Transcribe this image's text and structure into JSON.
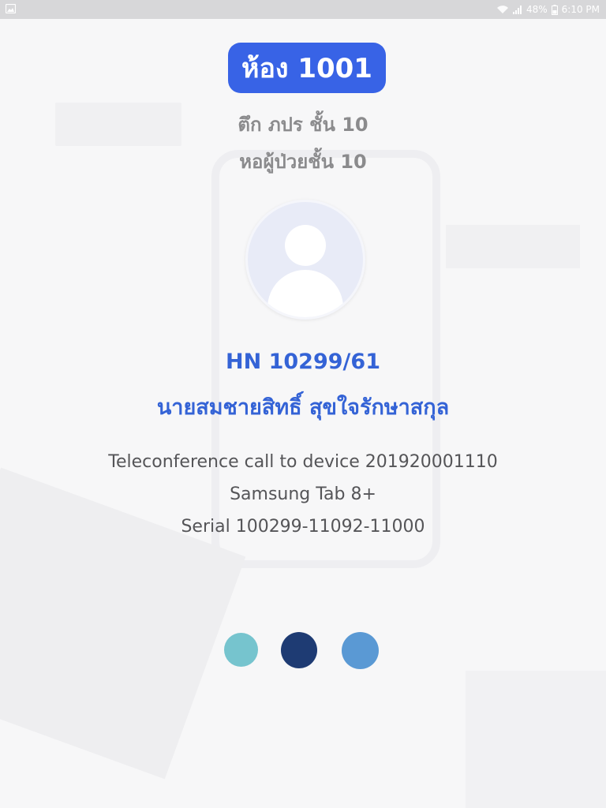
{
  "status_bar": {
    "battery": "48%",
    "time": "6:10 PM",
    "icons": [
      "gallery-icon",
      "wifi-icon",
      "signal-icon",
      "battery-icon"
    ]
  },
  "room": {
    "title": "ห้อง 1001",
    "building": "ตึก ภปร ชั้น 10",
    "ward": "หอผู้ป่วยชั้น 10"
  },
  "patient": {
    "hn": "HN 10299/61",
    "name": "นายสมชายสิทธิ์ สุขใจรักษาสกุล",
    "avatar_icon": "user-placeholder-icon"
  },
  "call_info": {
    "line1": "Teleconference call to device 201920001110",
    "line2": "Samsung Tab 8+",
    "line3": "Serial 100299-11092-11000"
  },
  "loading_dots": {
    "colors": [
      "#76c4ce",
      "#1e3b73",
      "#5a99d4"
    ]
  },
  "colors": {
    "accent": "#3863e6",
    "patient_text": "#3463d6",
    "muted": "#8b8b8d",
    "status_bar": "#d7d7d9"
  }
}
